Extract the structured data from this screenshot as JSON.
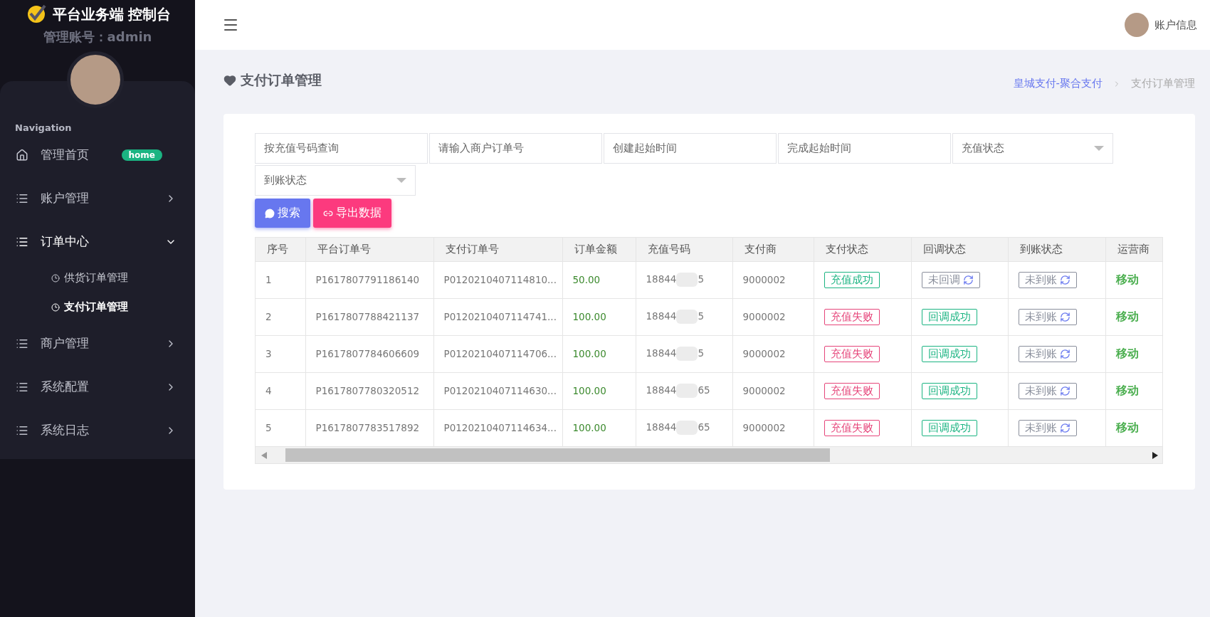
{
  "brand": {
    "title": "平台业务端 控制台",
    "account": "管理账号：admin"
  },
  "sidebar": {
    "heading": "Navigation",
    "items": [
      {
        "label": "管理首页",
        "kind": "home",
        "badge": "home",
        "selected": false
      },
      {
        "label": "账户管理",
        "kind": "list",
        "expanded": false,
        "selected": false
      },
      {
        "label": "订单中心",
        "kind": "list",
        "expanded": true,
        "selected": true,
        "children": [
          {
            "label": "供货订单管理",
            "selected": false
          },
          {
            "label": "支付订单管理",
            "selected": true
          }
        ]
      },
      {
        "label": "商户管理",
        "kind": "list",
        "expanded": false,
        "selected": false
      },
      {
        "label": "系统配置",
        "kind": "list",
        "expanded": false,
        "selected": false
      },
      {
        "label": "系统日志",
        "kind": "list",
        "expanded": false,
        "selected": false
      }
    ]
  },
  "header": {
    "account": "账户信息"
  },
  "page": {
    "title": "支付订单管理",
    "breadcrumb": [
      "皇城支付-聚合支付",
      "支付订单管理"
    ]
  },
  "filters": [
    {
      "kind": "input",
      "placeholder": "按充值号码查询"
    },
    {
      "kind": "input",
      "placeholder": "请输入商户订单号"
    },
    {
      "kind": "input",
      "placeholder": "创建起始时间"
    },
    {
      "kind": "input",
      "placeholder": "完成起始时间"
    },
    {
      "kind": "select",
      "placeholder": "充值状态"
    },
    {
      "kind": "select",
      "placeholder": "到账状态"
    }
  ],
  "buttons": [
    {
      "kind": "search",
      "label": "搜索"
    },
    {
      "kind": "export",
      "label": "导出数据"
    }
  ],
  "table": {
    "columns": [
      "序号",
      "平台订单号",
      "支付订单号",
      "订单金额",
      "充值号码",
      "支付商",
      "支付状态",
      "回调状态",
      "到账状态",
      "运营商"
    ],
    "rows": [
      {
        "index": "1",
        "platform_order": "P1617807791186140",
        "pay_order": "P0120210407114810...",
        "amount": "50.00",
        "phone_start": "18844",
        "phone_end": "5",
        "provider": "9000002",
        "pay_status": {
          "label": "充值成功",
          "kind": "success"
        },
        "callback_status": {
          "label": "未回调",
          "kind": "pending"
        },
        "arrival_status": {
          "label": "未到账",
          "kind": "pending"
        },
        "carrier": "移动"
      },
      {
        "index": "2",
        "platform_order": "P1617807788421137",
        "pay_order": "P0120210407114741...",
        "amount": "100.00",
        "phone_start": "18844",
        "phone_end": "5",
        "provider": "9000002",
        "pay_status": {
          "label": "充值失败",
          "kind": "fail"
        },
        "callback_status": {
          "label": "回调成功",
          "kind": "success"
        },
        "arrival_status": {
          "label": "未到账",
          "kind": "pending"
        },
        "carrier": "移动"
      },
      {
        "index": "3",
        "platform_order": "P1617807784606609",
        "pay_order": "P0120210407114706...",
        "amount": "100.00",
        "phone_start": "18844",
        "phone_end": "5",
        "provider": "9000002",
        "pay_status": {
          "label": "充值失败",
          "kind": "fail"
        },
        "callback_status": {
          "label": "回调成功",
          "kind": "success"
        },
        "arrival_status": {
          "label": "未到账",
          "kind": "pending"
        },
        "carrier": "移动"
      },
      {
        "index": "4",
        "platform_order": "P1617807780320512",
        "pay_order": "P0120210407114630...",
        "amount": "100.00",
        "phone_start": "18844",
        "phone_end": "65",
        "provider": "9000002",
        "pay_status": {
          "label": "充值失败",
          "kind": "fail"
        },
        "callback_status": {
          "label": "回调成功",
          "kind": "success"
        },
        "arrival_status": {
          "label": "未到账",
          "kind": "pending"
        },
        "carrier": "移动"
      },
      {
        "index": "5",
        "platform_order": "P1617807783517892",
        "pay_order": "P0120210407114634...",
        "amount": "100.00",
        "phone_start": "18844",
        "phone_end": "65",
        "provider": "9000002",
        "pay_status": {
          "label": "充值失败",
          "kind": "fail"
        },
        "callback_status": {
          "label": "回调成功",
          "kind": "success"
        },
        "arrival_status": {
          "label": "未到账",
          "kind": "pending"
        },
        "carrier": "移动"
      }
    ]
  }
}
